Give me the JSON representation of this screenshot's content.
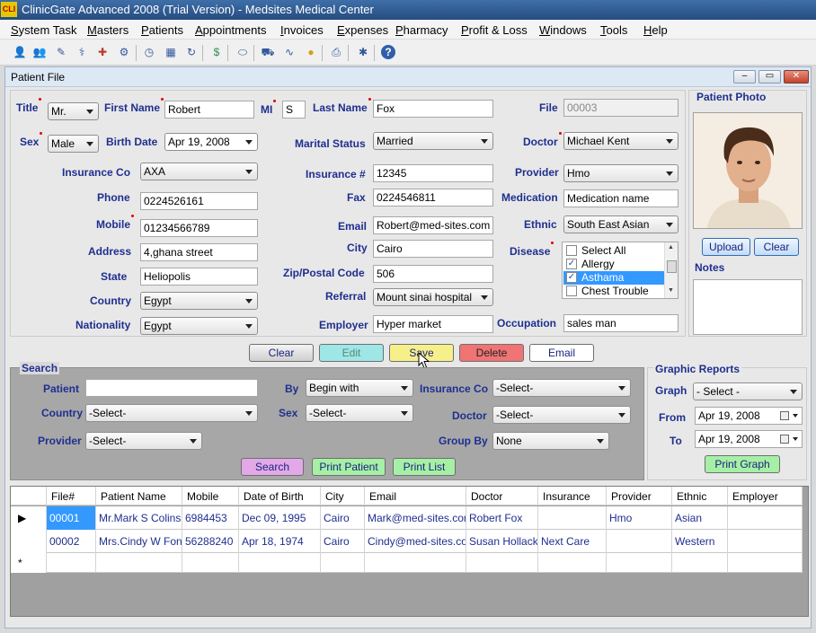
{
  "app": {
    "title": "ClinicGate Advanced 2008 (Trial Version) - Medsites Medical Center",
    "icon_text": "CLI"
  },
  "menu": [
    "System Task",
    "Masters",
    "Patients",
    "Appointments",
    "Invoices",
    "Expenses",
    "Pharmacy",
    "Profit & Loss",
    "Windows",
    "Tools",
    "Help"
  ],
  "toolbar_icons": [
    "user-icon",
    "users-icon",
    "pen-icon",
    "syringe-icon",
    "bandage-icon",
    "gear-icon",
    "clock-icon",
    "calendar-icon",
    "refresh-icon",
    "money-icon",
    "pill-icon",
    "cart-icon",
    "chart-icon",
    "coins-icon",
    "printer-icon",
    "settings-icon",
    "help-icon"
  ],
  "window": {
    "title": "Patient File",
    "min": "‒",
    "max": "▭",
    "close": "✕"
  },
  "form": {
    "title_label": "Title",
    "title_value": "Mr.",
    "first_name_label": "First Name",
    "first_name": "Robert",
    "mi_label": "MI",
    "mi": "S",
    "last_name_label": "Last Name",
    "last_name": "Fox",
    "file_label": "File",
    "file": "00003",
    "sex_label": "Sex",
    "sex": "Male",
    "birth_date_label": "Birth Date",
    "birth_date": "Apr 19, 2008",
    "marital_label": "Marital Status",
    "marital": "Married",
    "doctor_label": "Doctor",
    "doctor": "Michael Kent",
    "insurance_co_label": "Insurance Co",
    "insurance_co": "AXA",
    "insurance_no_label": "Insurance #",
    "insurance_no": "12345",
    "provider_label": "Provider",
    "provider": "Hmo",
    "phone_label": "Phone",
    "phone": "0224526161",
    "fax_label": "Fax",
    "fax": "0224546811",
    "medication_label": "Medication",
    "medication": "Medication name",
    "mobile_label": "Mobile",
    "mobile": "01234566789",
    "email_label": "Email",
    "email": "Robert@med-sites.com",
    "ethnic_label": "Ethnic",
    "ethnic": "South East Asian",
    "address_label": "Address",
    "address": "4,ghana street",
    "city_label": "City",
    "city": "Cairo",
    "disease_label": "Disease",
    "state_label": "State",
    "state": "Heliopolis",
    "zip_label": "Zip/Postal Code",
    "zip": "506",
    "country_label": "Country",
    "country": "Egypt",
    "referral_label": "Referral",
    "referral": "Mount sinai hospital",
    "nationality_label": "Nationality",
    "nationality": "Egypt",
    "employer_label": "Employer",
    "employer": "Hyper market",
    "occupation_label": "Occupation",
    "occupation": "sales man"
  },
  "disease_list": [
    {
      "label": "Select All",
      "checked": false,
      "selected": false
    },
    {
      "label": "Allergy",
      "checked": true,
      "selected": false
    },
    {
      "label": "Asthama",
      "checked": true,
      "selected": true
    },
    {
      "label": "Chest Trouble",
      "checked": false,
      "selected": false
    }
  ],
  "photo": {
    "title": "Patient Photo",
    "upload": "Upload",
    "clear": "Clear",
    "notes_label": "Notes"
  },
  "actions": {
    "clear": "Clear",
    "edit": "Edit",
    "save": "Save",
    "delete": "Delete",
    "email": "Email"
  },
  "search": {
    "title": "Search",
    "patient_label": "Patient",
    "patient_value": "",
    "by_label": "By",
    "by_value": "Begin with",
    "insurance_label": "Insurance Co",
    "insurance_value": "-Select-",
    "country_label": "Country",
    "country_value": "-Select-",
    "sex_label": "Sex",
    "sex_value": "-Select-",
    "doctor_label": "Doctor",
    "doctor_value": "-Select-",
    "provider_label": "Provider",
    "provider_value": "-Select-",
    "group_by_label": "Group By",
    "group_by_value": "None",
    "search_btn": "Search",
    "print_patient_btn": "Print Patient",
    "print_list_btn": "Print List"
  },
  "graph": {
    "title": "Graphic Reports",
    "graph_label": "Graph",
    "graph_value": "- Select -",
    "from_label": "From",
    "from_value": "Apr 19, 2008",
    "to_label": "To",
    "to_value": "Apr 19, 2008",
    "print_btn": "Print Graph"
  },
  "grid": {
    "columns": [
      "File#",
      "Patient Name",
      "Mobile",
      "Date of Birth",
      "City",
      "Email",
      "Doctor",
      "Insurance",
      "Provider",
      "Ethnic",
      "Employer"
    ],
    "rows": [
      [
        "00001",
        "Mr.Mark S Colins",
        "6984453",
        "Dec 09, 1995",
        "Cairo",
        "Mark@med-sites.com",
        "Robert Fox",
        "",
        "Hmo",
        "Asian",
        ""
      ],
      [
        "00002",
        "Mrs.Cindy W Fong",
        "56288240",
        "Apr 18, 1974",
        "Cairo",
        "Cindy@med-sites.com",
        "Susan Hollack",
        "Next Care",
        "",
        "Western",
        ""
      ]
    ],
    "current_marker": "▶",
    "new_marker": "*"
  }
}
